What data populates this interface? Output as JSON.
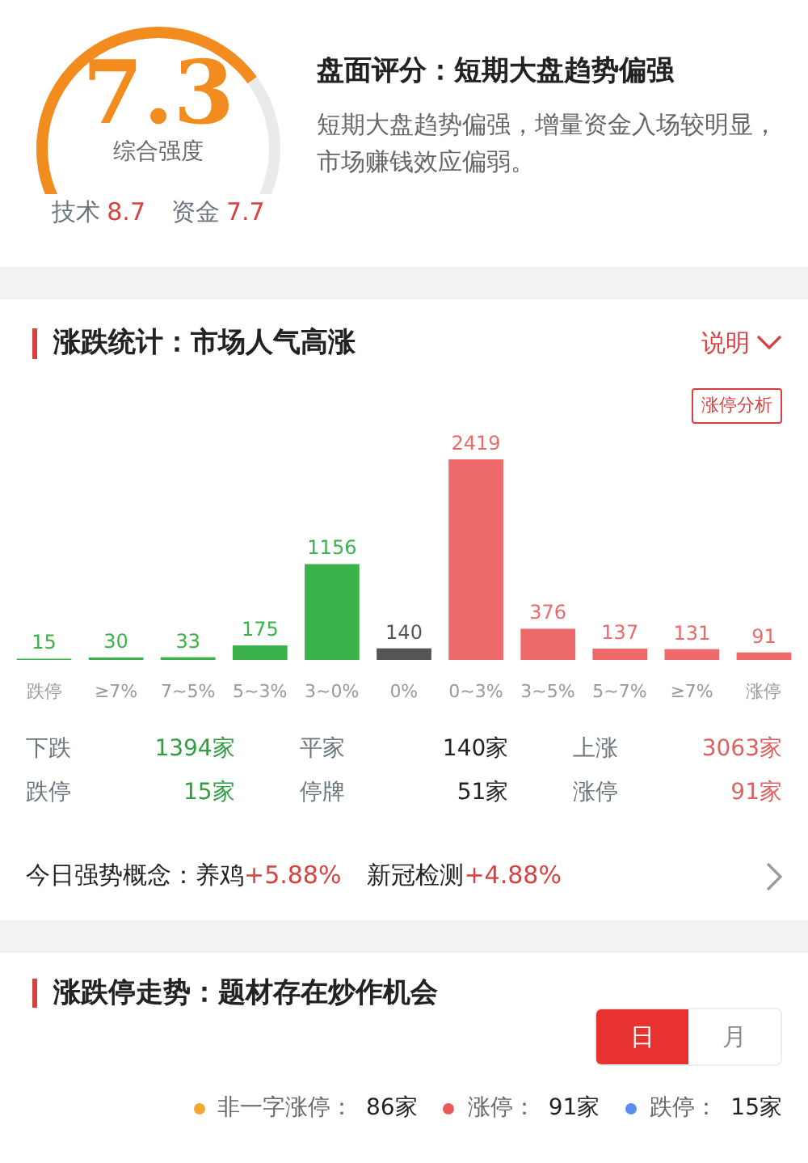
{
  "score": {
    "value": "7.3",
    "label": "综合强度",
    "subs": [
      {
        "label": "技术",
        "value": "8.7"
      },
      {
        "label": "资金",
        "value": "7.7"
      }
    ]
  },
  "rating": {
    "title": "盘面评分：短期大盘趋势偏强",
    "description": "短期大盘趋势偏强，增量资金入场较明显，市场赚钱效应偏弱。"
  },
  "stats": {
    "title": "涨跌统计：市场人气高涨",
    "help": "说明",
    "analysis_button": "涨停分析",
    "chart_data": {
      "type": "bar",
      "categories": [
        "跌停",
        "≥7%",
        "7~5%",
        "5~3%",
        "3~0%",
        "0%",
        "0~3%",
        "3~5%",
        "5~7%",
        "≥7%",
        "涨停"
      ],
      "data_labels": true,
      "series": [
        {
          "values": [
            15,
            30,
            33,
            175,
            1156,
            140,
            2419,
            376,
            137,
            131,
            91
          ],
          "colors": [
            "#3bb34a",
            "#3bb34a",
            "#3bb34a",
            "#3bb34a",
            "#3bb34a",
            "#555555",
            "#ee6a6a",
            "#ee6a6a",
            "#ee6a6a",
            "#ee6a6a",
            "#ee6a6a"
          ]
        }
      ]
    },
    "summary": [
      {
        "label": "下跌",
        "value": "1394家",
        "color": "#2e9e3e"
      },
      {
        "label": "平家",
        "value": "140家",
        "color": "#222222"
      },
      {
        "label": "上涨",
        "value": "3063家",
        "color": "#e06060"
      },
      {
        "label": "跌停",
        "value": "15家",
        "color": "#2e9e3e"
      },
      {
        "label": "停牌",
        "value": "51家",
        "color": "#222222"
      },
      {
        "label": "涨停",
        "value": "91家",
        "color": "#e06060"
      }
    ],
    "concepts": {
      "label": "今日强势概念：",
      "items": [
        {
          "name": "养鸡",
          "change": "+5.88%"
        },
        {
          "name": "新冠检测",
          "change": "+4.88%"
        }
      ]
    }
  },
  "limit_trend": {
    "title": "涨跌停走势：题材存在炒作机会",
    "periods": [
      {
        "label": "日",
        "selected": true
      },
      {
        "label": "月",
        "selected": false
      }
    ],
    "legend": [
      {
        "label": "非一字涨停：",
        "value": "86家",
        "color": "#f0a830"
      },
      {
        "label": "涨停：",
        "value": "91家",
        "color": "#e85a5a"
      },
      {
        "label": "跌停：",
        "value": "15家",
        "color": "#5b8def"
      }
    ]
  }
}
